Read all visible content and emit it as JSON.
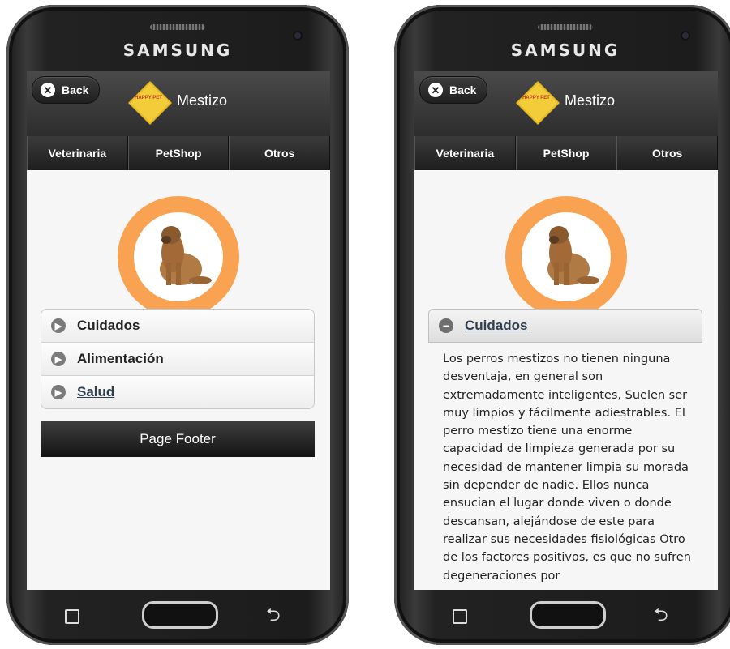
{
  "device": {
    "brand": "SAMSUNG"
  },
  "app": {
    "back_label": "Back",
    "title": "Mestizo",
    "logo_text": "HAPPY PET",
    "nav": [
      "Veterinaria",
      "PetShop",
      "Otros"
    ]
  },
  "left_screen": {
    "sections": [
      "Cuidados",
      "Alimentación",
      "Salud"
    ],
    "footer": "Page Footer"
  },
  "right_screen": {
    "expanded_section": "Cuidados",
    "content": "Los perros mestizos no tienen ninguna desventaja, en general son extremadamente inteligentes, Suelen ser muy limpios y fácilmente adiestrables. El perro mestizo tiene una enorme capacidad de limpieza generada por su necesidad de mantener limpia su morada sin depender de nadie. Ellos nunca ensucian el lugar donde viven o donde descansan, alejándose de este para realizar sus necesidades fisiológicas Otro de los factores positivos, es que no sufren degeneraciones por"
  },
  "colors": {
    "badge_ring": "#f9a252",
    "logo_yellow": "#f3cc3a",
    "header_dark": "#2d2d2d",
    "link": "#2f3e4e"
  },
  "icons": [
    "close-icon",
    "arrow-right-icon",
    "minus-icon",
    "recent-apps-icon",
    "home-button",
    "back-arrow-icon"
  ]
}
